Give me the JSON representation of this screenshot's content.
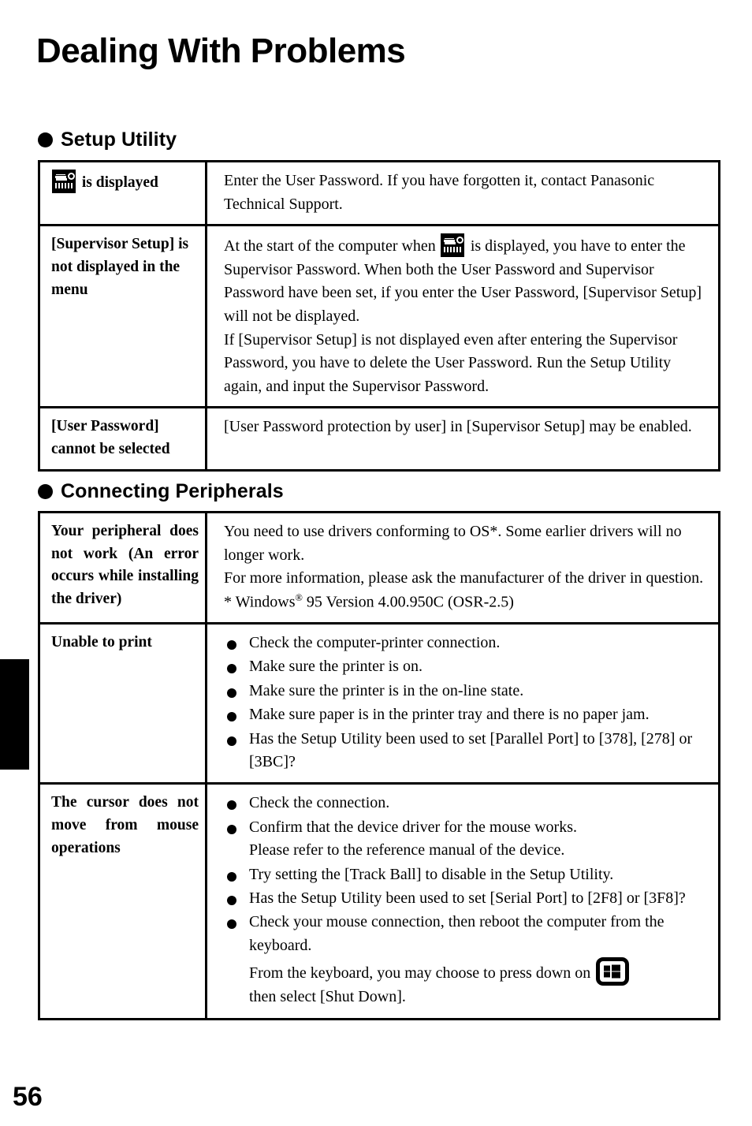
{
  "document": {
    "title": "Dealing With Problems",
    "page_number": "56"
  },
  "icons": {
    "password_key": "password-key-icon",
    "windows_key": "windows-logo-key-icon",
    "section_bullet": "filled-circle-bullet-icon",
    "edge_tab": "page-edge-tab-marker"
  },
  "sections": [
    {
      "id": "setup-utility",
      "heading": "Setup Utility",
      "rows": [
        {
          "label_prefix_icon": "password-key-icon",
          "label": "is displayed",
          "body": [
            "Enter the User Password. If you have forgotten it, contact Panasonic Technical Support."
          ]
        },
        {
          "label": "[Supervisor Setup] is not displayed in the menu",
          "body": [
            "At the start of the computer when  is displayed, you have to enter the Supervisor Password.  When both the User Password and Supervisor Password have been set,  if you enter the User Password, [Supervisor Setup] will not be displayed.",
            "If  [Supervisor Setup] is not displayed even after entering the Supervisor Password, you have to delete the User Password. Run the Setup Utility again, and input the Supervisor Password."
          ],
          "body_inline_icon": "password-key-icon",
          "body_part_1a": "At the start of the computer when",
          "body_part_1b": "is displayed, you have to enter the Supervisor Password.  When both the User Password and Supervisor Password have been set,  if you enter the User Password, [Supervisor Setup] will not be displayed.",
          "body_part_2": "If  [Supervisor Setup] is not displayed even after entering the Supervisor Password, you have to delete the User Password. Run the Setup Utility again, and input the Supervisor Password."
        },
        {
          "label": "[User Password] cannot be selected",
          "body": [
            "[User Password protection by user] in [Supervisor Setup] may be enabled."
          ]
        }
      ]
    },
    {
      "id": "connecting-peripherals",
      "heading": "Connecting Peripherals",
      "rows": [
        {
          "label": "Your peripheral does not work (An error occurs while installing the driver)",
          "body_lines": [
            "You need to use drivers conforming to OS*.  Some earlier drivers will no longer work.",
            "For more information, please ask the manufacturer of the driver in question."
          ],
          "footnote_pre": "* Windows",
          "footnote_sup": "®",
          "footnote_post": " 95 Version 4.00.950C (OSR-2.5)"
        },
        {
          "label": "Unable to print",
          "bullets": [
            {
              "text": "Check the computer-printer connection."
            },
            {
              "text": "Make sure the printer is on."
            },
            {
              "text": "Make sure the printer is in the on-line state."
            },
            {
              "text": "Make sure paper is in the printer tray and there is no paper jam."
            },
            {
              "text": "Has the Setup Utility been used to set [Parallel Port] to [378], [278] or [3BC]?"
            }
          ]
        },
        {
          "label": "The cursor does not move from mouse operations",
          "bullets": [
            {
              "text": "Check the connection."
            },
            {
              "text": "Confirm that the device driver for the mouse works.",
              "sub": "Please refer to the reference manual of the device."
            },
            {
              "text": "Try setting the [Track Ball] to disable in the Setup Utility."
            },
            {
              "text": "Has the Setup Utility been used to set [Serial Port] to [2F8] or [3F8]?"
            },
            {
              "text": "Check your mouse connection, then reboot the computer from the keyboard.",
              "sub_a": "From the keyboard, you may choose to press down on",
              "sub_icon": "windows-logo-key-icon",
              "sub_b": "then select [Shut Down]."
            }
          ]
        }
      ]
    }
  ]
}
